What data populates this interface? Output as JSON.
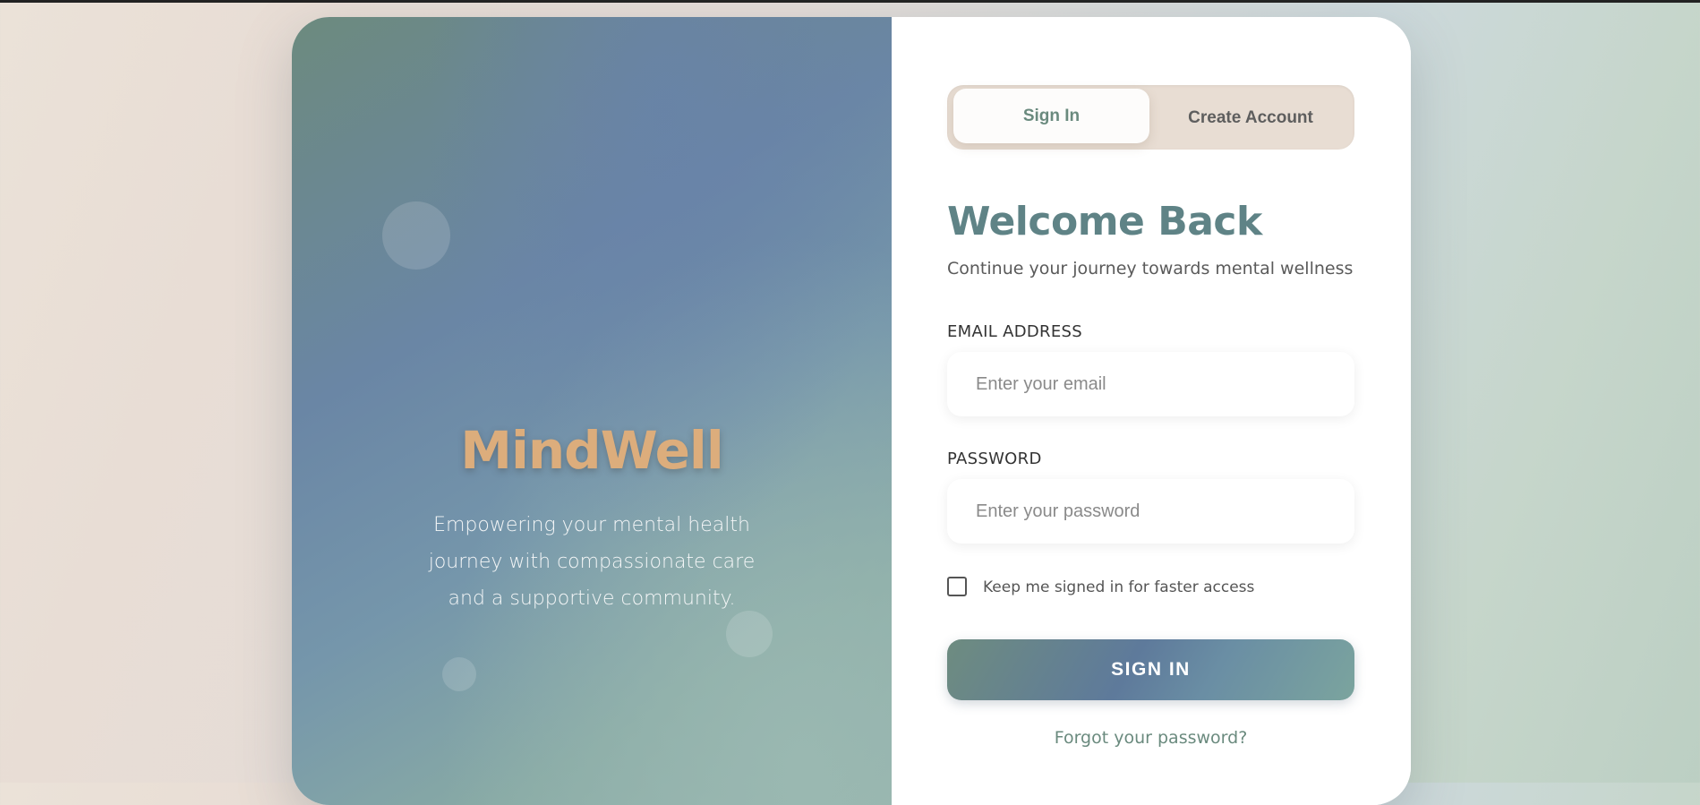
{
  "brand": {
    "name": "MindWell",
    "tagline": "Empowering your mental health journey with compassionate care and a supportive community."
  },
  "tabs": [
    {
      "label": "Sign In",
      "active": true
    },
    {
      "label": "Create Account",
      "active": false
    }
  ],
  "form": {
    "heading": "Welcome Back",
    "subheading": "Continue your journey towards mental wellness",
    "email": {
      "label": "EMAIL ADDRESS",
      "placeholder": "Enter your email",
      "value": ""
    },
    "password": {
      "label": "PASSWORD",
      "placeholder": "Enter your password",
      "value": ""
    },
    "remember": {
      "label": "Keep me signed in for faster access",
      "checked": false
    },
    "submit_label": "SIGN IN",
    "forgot_label": "Forgot your password?"
  },
  "colors": {
    "accent_green": "#6a8a7e",
    "heading_teal": "#5f8386",
    "brand_gold": "#dcad7c",
    "tab_track": "#e8ddd3"
  }
}
